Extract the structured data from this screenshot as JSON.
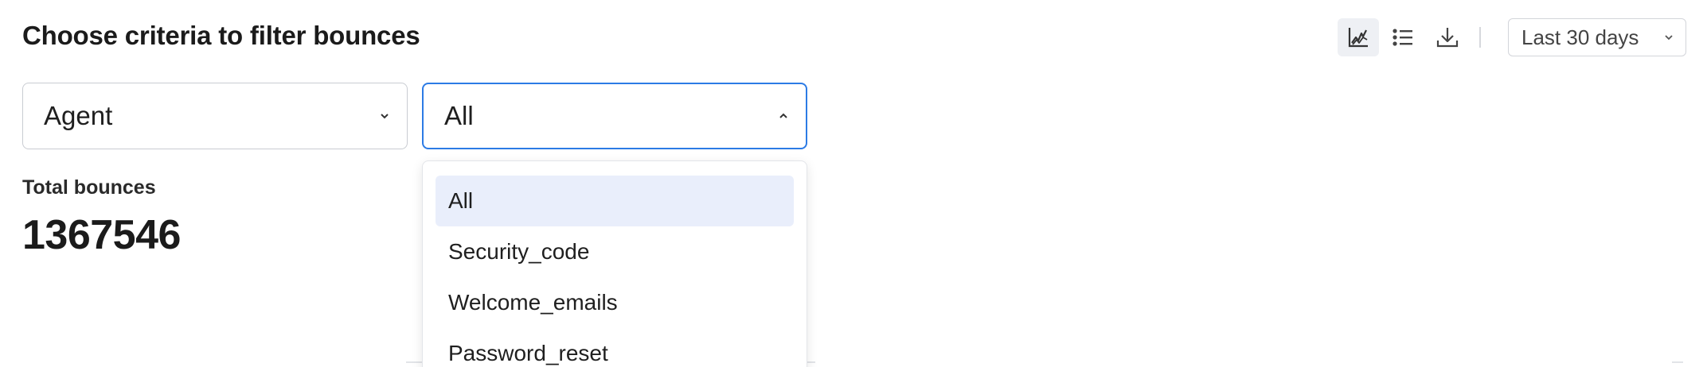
{
  "header": {
    "title": "Choose criteria to filter bounces"
  },
  "toolbar": {
    "icons": [
      "chart-line-icon",
      "list-icon",
      "download-icon"
    ],
    "range_label": "Last 30 days"
  },
  "filters": {
    "criteria_label": "Agent",
    "value_label": "All"
  },
  "summary": {
    "label": "Total bounces",
    "value": "1367546"
  },
  "dropdown": {
    "options": [
      {
        "label": "All",
        "selected": true
      },
      {
        "label": "Security_code",
        "selected": false
      },
      {
        "label": "Welcome_emails",
        "selected": false
      },
      {
        "label": "Password_reset",
        "selected": false
      }
    ]
  },
  "colors": {
    "accent": "#2c7be5",
    "selected_bg": "#e9eefb",
    "active_tool_bg": "#eef0f4"
  }
}
